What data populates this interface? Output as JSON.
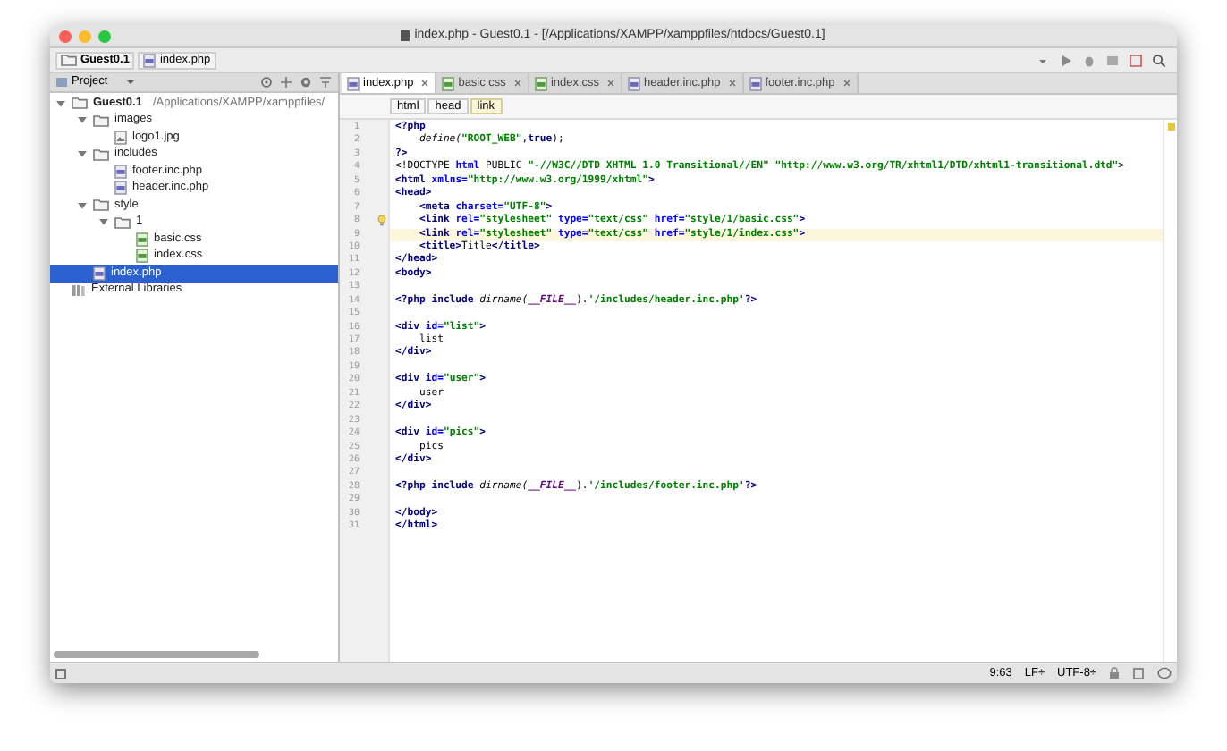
{
  "window": {
    "title": "index.php - Guest0.1 - [/Applications/XAMPP/xamppfiles/htdocs/Guest0.1]"
  },
  "nav_bar": {
    "crumbs": [
      {
        "label": "Guest0.1",
        "kind": "folder"
      },
      {
        "label": "index.php",
        "kind": "php"
      }
    ]
  },
  "project_panel": {
    "title": "Project",
    "tree": [
      {
        "label": "Guest0.1",
        "path": "/Applications/XAMPP/xamppfiles/",
        "kind": "folder",
        "expanded": true,
        "selected": false,
        "bold": true,
        "children": [
          {
            "label": "images",
            "kind": "folder",
            "expanded": true,
            "selected": false,
            "children": [
              {
                "label": "logo1.jpg",
                "kind": "image",
                "selected": false
              }
            ]
          },
          {
            "label": "includes",
            "kind": "folder",
            "expanded": true,
            "selected": false,
            "children": [
              {
                "label": "footer.inc.php",
                "kind": "php",
                "selected": false
              },
              {
                "label": "header.inc.php",
                "kind": "php",
                "selected": false
              }
            ]
          },
          {
            "label": "style",
            "kind": "folder",
            "expanded": true,
            "selected": false,
            "children": [
              {
                "label": "1",
                "kind": "folder",
                "expanded": true,
                "selected": false,
                "children": [
                  {
                    "label": "basic.css",
                    "kind": "css",
                    "selected": false
                  },
                  {
                    "label": "index.css",
                    "kind": "css",
                    "selected": false
                  }
                ]
              }
            ]
          },
          {
            "label": "index.php",
            "kind": "php",
            "selected": true
          }
        ]
      },
      {
        "label": "External Libraries",
        "kind": "library",
        "selected": false
      }
    ]
  },
  "editor": {
    "tabs": [
      {
        "label": "index.php",
        "kind": "php",
        "selected": true
      },
      {
        "label": "basic.css",
        "kind": "css",
        "selected": false
      },
      {
        "label": "index.css",
        "kind": "css",
        "selected": false
      },
      {
        "label": "header.inc.php",
        "kind": "php",
        "selected": false
      },
      {
        "label": "footer.inc.php",
        "kind": "php",
        "selected": false
      }
    ],
    "breadcrumbs": [
      {
        "label": "html",
        "selected": false
      },
      {
        "label": "head",
        "selected": false
      },
      {
        "label": "link",
        "selected": true
      }
    ],
    "lines": [
      {
        "number": "1",
        "current": false,
        "hint": false,
        "segments": [
          {
            "text": "<?php",
            "kind": "php"
          }
        ]
      },
      {
        "number": "2",
        "current": false,
        "hint": false,
        "segments": [
          {
            "text": "    define(",
            "kind": "fn"
          },
          {
            "text": "\"ROOT_WEB\"",
            "kind": "str"
          },
          {
            "text": ",",
            "kind": "text"
          },
          {
            "text": "true",
            "kind": "php"
          },
          {
            "text": ");",
            "kind": "text"
          }
        ]
      },
      {
        "number": "3",
        "current": false,
        "hint": false,
        "segments": [
          {
            "text": "?>",
            "kind": "php"
          }
        ]
      },
      {
        "number": "4",
        "current": false,
        "hint": false,
        "segments": [
          {
            "text": "<!DOCTYPE ",
            "kind": "text"
          },
          {
            "text": "html",
            "kind": "attr"
          },
          {
            "text": " PUBLIC ",
            "kind": "text"
          },
          {
            "text": "\"-//W3C//DTD XHTML 1.0 Transitional//EN\" \"http://www.w3.org/TR/xhtml1/DTD/xhtml1-transitional.dtd\"",
            "kind": "str"
          },
          {
            "text": ">",
            "kind": "text"
          }
        ]
      },
      {
        "number": "5",
        "current": false,
        "hint": false,
        "segments": [
          {
            "text": "<html ",
            "kind": "tag"
          },
          {
            "text": "xmlns=",
            "kind": "attr"
          },
          {
            "text": "\"http://www.w3.org/1999/xhtml\"",
            "kind": "str"
          },
          {
            "text": ">",
            "kind": "tag"
          }
        ]
      },
      {
        "number": "6",
        "current": false,
        "hint": false,
        "segments": [
          {
            "text": "<head>",
            "kind": "tag"
          }
        ]
      },
      {
        "number": "7",
        "current": false,
        "hint": false,
        "segments": [
          {
            "text": "    <meta ",
            "kind": "tag"
          },
          {
            "text": "charset=",
            "kind": "attr"
          },
          {
            "text": "\"UTF-8\"",
            "kind": "str"
          },
          {
            "text": ">",
            "kind": "tag"
          }
        ]
      },
      {
        "number": "8",
        "current": false,
        "hint": true,
        "segments": [
          {
            "text": "    <link ",
            "kind": "tag"
          },
          {
            "text": "rel=",
            "kind": "attr"
          },
          {
            "text": "\"stylesheet\" ",
            "kind": "str"
          },
          {
            "text": "type=",
            "kind": "attr"
          },
          {
            "text": "\"text/css\" ",
            "kind": "str"
          },
          {
            "text": "href=",
            "kind": "attr"
          },
          {
            "text": "\"style/1/basic.css\"",
            "kind": "str"
          },
          {
            "text": ">",
            "kind": "tag"
          }
        ]
      },
      {
        "number": "9",
        "current": true,
        "hint": false,
        "segments": [
          {
            "text": "    <link ",
            "kind": "tag"
          },
          {
            "text": "rel=",
            "kind": "attr"
          },
          {
            "text": "\"stylesheet\" ",
            "kind": "str"
          },
          {
            "text": "type=",
            "kind": "attr"
          },
          {
            "text": "\"text/css\" ",
            "kind": "str"
          },
          {
            "text": "href=",
            "kind": "attr"
          },
          {
            "text": "\"style/1/index.css\"",
            "kind": "str"
          },
          {
            "text": ">",
            "kind": "tag"
          }
        ]
      },
      {
        "number": "10",
        "current": false,
        "hint": false,
        "segments": [
          {
            "text": "    <title>",
            "kind": "tag"
          },
          {
            "text": "Title",
            "kind": "text"
          },
          {
            "text": "</title>",
            "kind": "tag"
          }
        ]
      },
      {
        "number": "11",
        "current": false,
        "hint": false,
        "segments": [
          {
            "text": "</head>",
            "kind": "tag"
          }
        ]
      },
      {
        "number": "12",
        "current": false,
        "hint": false,
        "segments": [
          {
            "text": "<body>",
            "kind": "tag"
          }
        ]
      },
      {
        "number": "13",
        "current": false,
        "hint": false
      },
      {
        "number": "14",
        "current": false,
        "hint": false,
        "segments": [
          {
            "text": "<?php include ",
            "kind": "php"
          },
          {
            "text": "dirname(",
            "kind": "fn"
          },
          {
            "text": "__FILE__",
            "kind": "const"
          },
          {
            "text": ").",
            "kind": "text"
          },
          {
            "text": "'/includes/header.inc.php'",
            "kind": "str"
          },
          {
            "text": "?>",
            "kind": "php"
          }
        ]
      },
      {
        "number": "15",
        "current": false,
        "hint": false
      },
      {
        "number": "16",
        "current": false,
        "hint": false,
        "segments": [
          {
            "text": "<div ",
            "kind": "tag"
          },
          {
            "text": "id=",
            "kind": "attr"
          },
          {
            "text": "\"list\"",
            "kind": "str"
          },
          {
            "text": ">",
            "kind": "tag"
          }
        ]
      },
      {
        "number": "17",
        "current": false,
        "hint": false,
        "segments": [
          {
            "text": "    list",
            "kind": "text"
          }
        ]
      },
      {
        "number": "18",
        "current": false,
        "hint": false,
        "segments": [
          {
            "text": "</div>",
            "kind": "tag"
          }
        ]
      },
      {
        "number": "19",
        "current": false,
        "hint": false
      },
      {
        "number": "20",
        "current": false,
        "hint": false,
        "segments": [
          {
            "text": "<div ",
            "kind": "tag"
          },
          {
            "text": "id=",
            "kind": "attr"
          },
          {
            "text": "\"user\"",
            "kind": "str"
          },
          {
            "text": ">",
            "kind": "tag"
          }
        ]
      },
      {
        "number": "21",
        "current": false,
        "hint": false,
        "segments": [
          {
            "text": "    user",
            "kind": "text"
          }
        ]
      },
      {
        "number": "22",
        "current": false,
        "hint": false,
        "segments": [
          {
            "text": "</div>",
            "kind": "tag"
          }
        ]
      },
      {
        "number": "23",
        "current": false,
        "hint": false
      },
      {
        "number": "24",
        "current": false,
        "hint": false,
        "segments": [
          {
            "text": "<div ",
            "kind": "tag"
          },
          {
            "text": "id=",
            "kind": "attr"
          },
          {
            "text": "\"pics\"",
            "kind": "str"
          },
          {
            "text": ">",
            "kind": "tag"
          }
        ]
      },
      {
        "number": "25",
        "current": false,
        "hint": false,
        "segments": [
          {
            "text": "    pics",
            "kind": "text"
          }
        ]
      },
      {
        "number": "26",
        "current": false,
        "hint": false,
        "segments": [
          {
            "text": "</div>",
            "kind": "tag"
          }
        ]
      },
      {
        "number": "27",
        "current": false,
        "hint": false
      },
      {
        "number": "28",
        "current": false,
        "hint": false,
        "segments": [
          {
            "text": "<?php include ",
            "kind": "php"
          },
          {
            "text": "dirname(",
            "kind": "fn"
          },
          {
            "text": "__FILE__",
            "kind": "const"
          },
          {
            "text": ").",
            "kind": "text"
          },
          {
            "text": "'/includes/footer.inc.php'",
            "kind": "str"
          },
          {
            "text": "?>",
            "kind": "php"
          }
        ]
      },
      {
        "number": "29",
        "current": false,
        "hint": false
      },
      {
        "number": "30",
        "current": false,
        "hint": false,
        "segments": [
          {
            "text": "</body>",
            "kind": "tag"
          }
        ]
      },
      {
        "number": "31",
        "current": false,
        "hint": false,
        "segments": [
          {
            "text": "</html>",
            "kind": "tag"
          }
        ]
      }
    ]
  },
  "status_bar": {
    "position": "9:63",
    "line_separator": "LF÷",
    "encoding": "UTF-8÷"
  }
}
